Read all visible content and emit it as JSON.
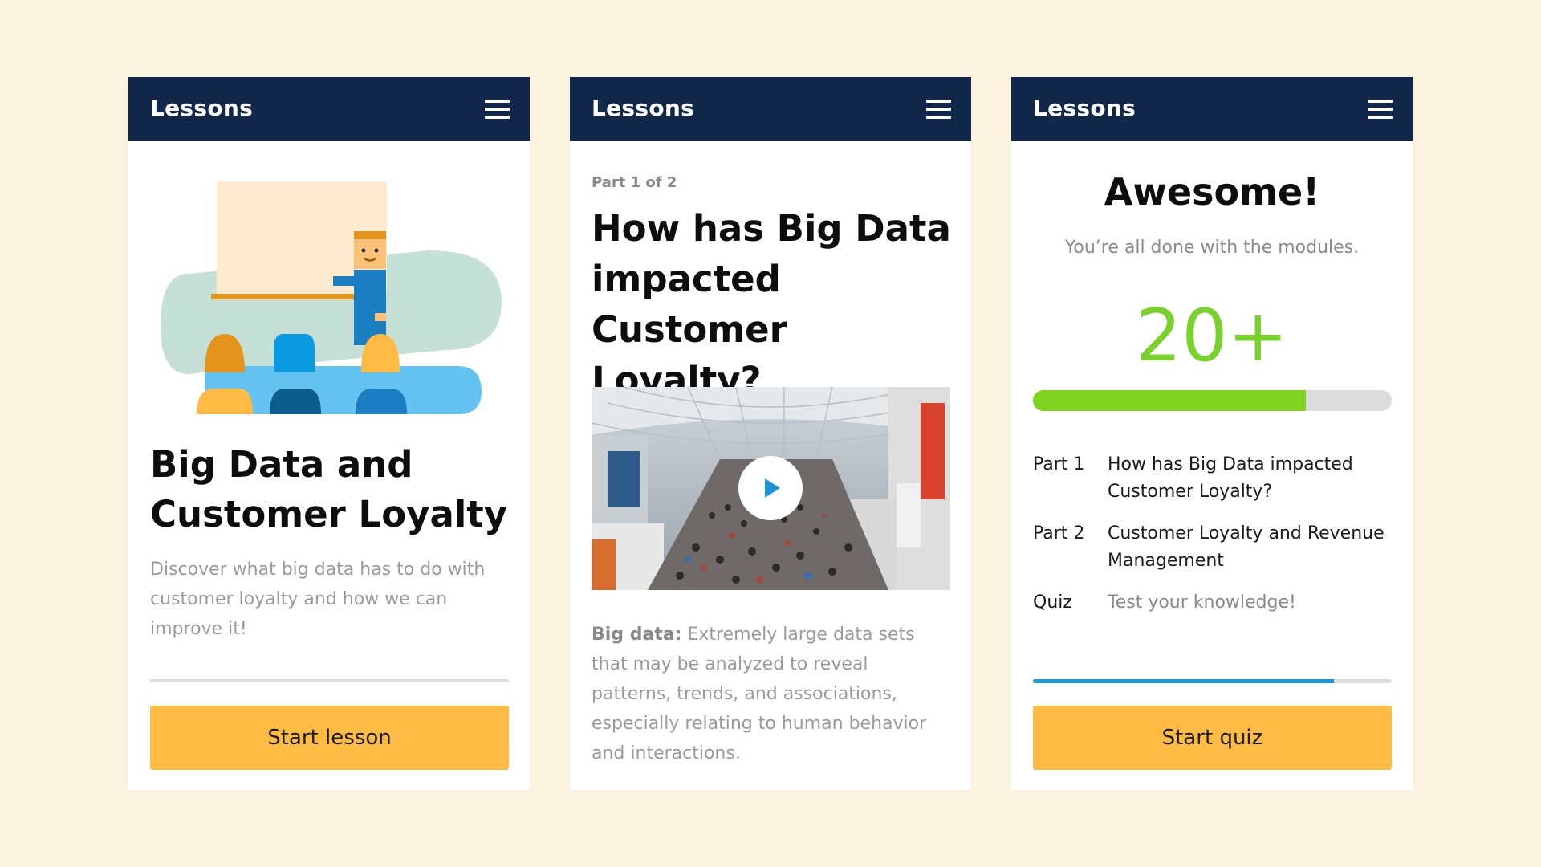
{
  "header": {
    "title": "Lessons",
    "menu_icon": "hamburger-menu-icon"
  },
  "card1": {
    "illustration": "teacher-classroom-illustration",
    "title": "Big Data and Customer Loyalty",
    "description": "Discover what big data has to do with customer loyalty and how we can improve it!",
    "button_label": "Start lesson"
  },
  "card2": {
    "part_label": "Part 1 of 2",
    "title": "How has Big Data impacted Customer Loyalty?",
    "video_icon": "play-icon",
    "definition_term": "Big data:",
    "definition_text": " Extremely large data sets that may be analyzed to reveal patterns, trends, and associations, especially relating to human behavior and interactions."
  },
  "card3": {
    "title": "Awesome!",
    "subtitle": "You’re all done with the modules.",
    "score": "20+",
    "score_progress": 0.76,
    "parts": [
      {
        "key": "Part 1",
        "value": "How has Big Data impacted Customer Loyalty?"
      },
      {
        "key": "Part 2",
        "value": "Customer Loyalty and Revenue Management"
      },
      {
        "key": "Quiz",
        "value": "Test your knowledge!"
      }
    ],
    "lesson_progress": 0.84,
    "button_label": "Start quiz"
  },
  "colors": {
    "background": "#fdf5e1",
    "header": "#12284a",
    "button": "#fdbb43",
    "score_green": "#78d22b",
    "progress_blue": "#1d93d8"
  }
}
